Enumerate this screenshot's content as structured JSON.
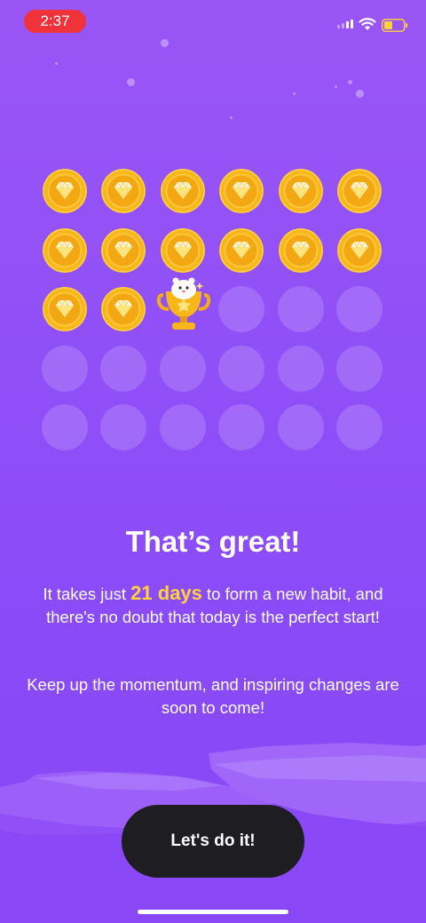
{
  "status_bar": {
    "time": "2:37",
    "icons": [
      "signal-icon",
      "wifi-icon",
      "battery-icon"
    ]
  },
  "habit_grid": {
    "completed_days": 14,
    "trophy_day": 15,
    "total_days": 30,
    "coin_icon": "diamond-coin-icon",
    "milestone_icon": "trophy-icon"
  },
  "content": {
    "title": "That’s great!",
    "paragraph1_before": "It takes just ",
    "paragraph1_highlight": "21 days",
    "paragraph1_after": " to form a new habit, and there's no doubt that today is the perfect start!",
    "paragraph2": "Keep up the momentum, and inspiring changes are soon to come!"
  },
  "cta": {
    "label": "Let's do it!"
  },
  "colors": {
    "background": "#9150f7",
    "highlight": "#ffd23b",
    "button": "#1e1d22",
    "status_pill": "#f0323a",
    "coin": "#f7b719"
  }
}
